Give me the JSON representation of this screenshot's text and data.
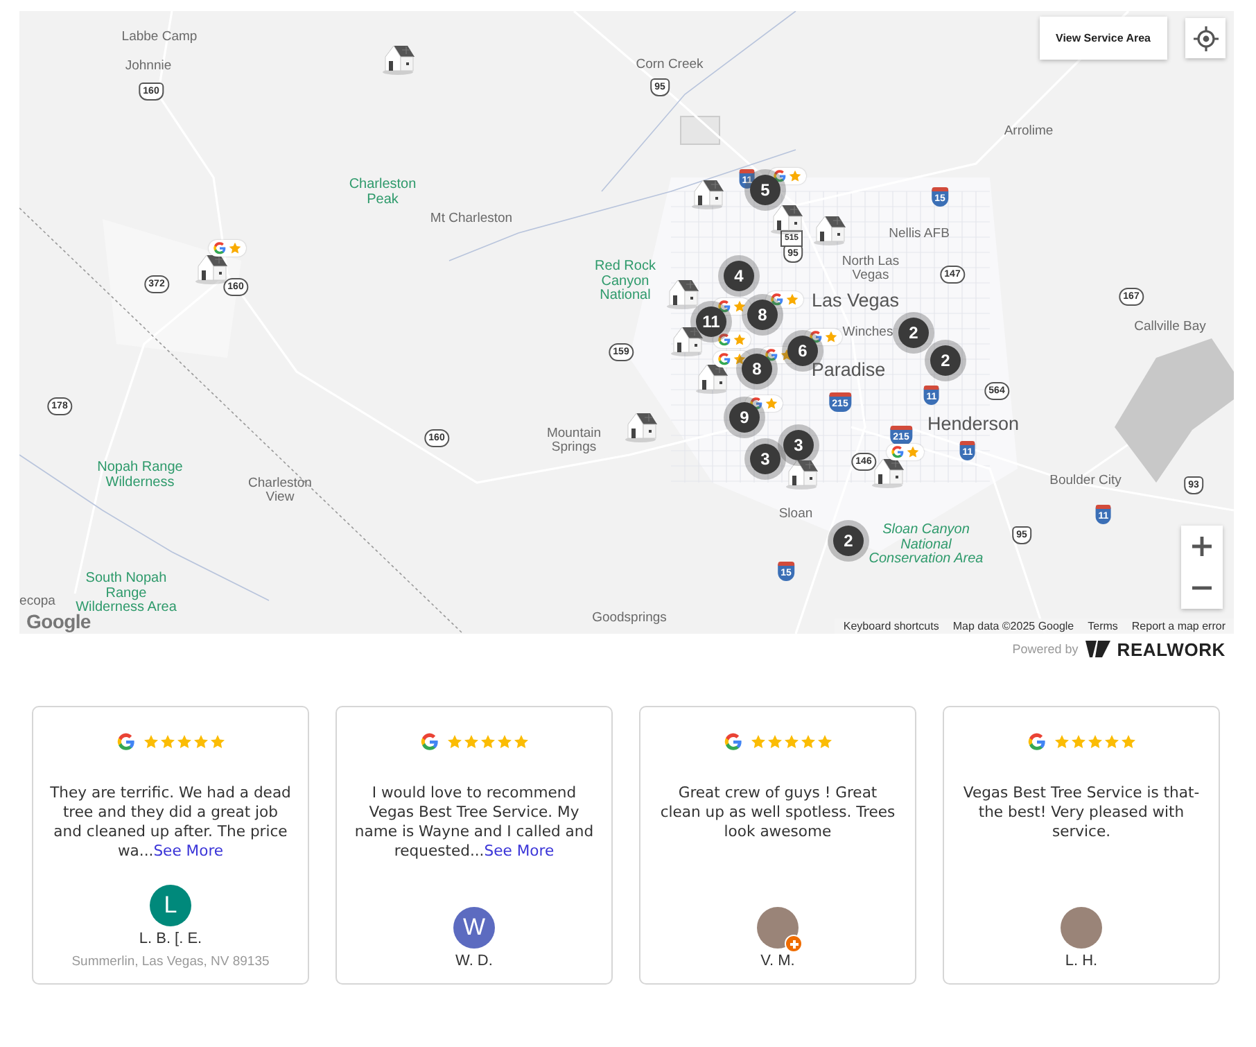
{
  "map": {
    "service_area_button": "View Service Area",
    "place_labels": [
      {
        "kind": "place",
        "text": "Labbe Camp"
      },
      {
        "kind": "place",
        "text": "Johnnie"
      },
      {
        "kind": "place",
        "text": "Corn Creek"
      },
      {
        "kind": "place",
        "text": "Arrolime"
      },
      {
        "kind": "park",
        "text": "Charleston Peak"
      },
      {
        "kind": "place",
        "text": "Mt Charleston"
      },
      {
        "kind": "park",
        "text": "Red Rock Canyon National"
      },
      {
        "kind": "place",
        "text": "Nellis AFB"
      },
      {
        "kind": "place",
        "text": "North Las Vegas"
      },
      {
        "kind": "city",
        "text": "Las Vegas"
      },
      {
        "kind": "place",
        "text": "Winches"
      },
      {
        "kind": "city",
        "text": "Paradise"
      },
      {
        "kind": "city",
        "text": "Henderson"
      },
      {
        "kind": "place",
        "text": "Mountain Springs"
      },
      {
        "kind": "park",
        "text": "Nopah Range Wilderness"
      },
      {
        "kind": "place",
        "text": "Charleston View"
      },
      {
        "kind": "place",
        "text": "Boulder City"
      },
      {
        "kind": "place",
        "text": "Callville Bay"
      },
      {
        "kind": "place",
        "text": "Sloan"
      },
      {
        "kind": "park",
        "text": "Sloan Canyon National Conservation Area"
      },
      {
        "kind": "park",
        "text": "South Nopah Range Wilderness Area"
      },
      {
        "kind": "place",
        "text": "Goodsprings"
      },
      {
        "kind": "place",
        "text": "ecopa"
      }
    ],
    "shields": [
      {
        "kind": "us",
        "text": "160"
      },
      {
        "kind": "us",
        "text": "95"
      },
      {
        "kind": "state",
        "text": "160"
      },
      {
        "kind": "state",
        "text": "372"
      },
      {
        "kind": "state",
        "text": "178"
      },
      {
        "kind": "state",
        "text": "160"
      },
      {
        "kind": "state",
        "text": "159"
      },
      {
        "kind": "interstate",
        "text": "15"
      },
      {
        "kind": "interstate",
        "text": "11"
      },
      {
        "kind": "us",
        "text": "95"
      },
      {
        "kind": "business",
        "text": "515"
      },
      {
        "kind": "state",
        "text": "147"
      },
      {
        "kind": "state",
        "text": "167"
      },
      {
        "kind": "interstate",
        "text": "215"
      },
      {
        "kind": "interstate",
        "text": "11"
      },
      {
        "kind": "state",
        "text": "564"
      },
      {
        "kind": "interstate",
        "text": "215"
      },
      {
        "kind": "state",
        "text": "146"
      },
      {
        "kind": "interstate",
        "text": "11"
      },
      {
        "kind": "us",
        "text": "93"
      },
      {
        "kind": "interstate",
        "text": "11"
      },
      {
        "kind": "us",
        "text": "95"
      },
      {
        "kind": "interstate",
        "text": "15"
      }
    ],
    "clusters": [
      "5",
      "4",
      "8",
      "11",
      "6",
      "8",
      "2",
      "2",
      "9",
      "3",
      "3",
      "2"
    ],
    "logo": "Google",
    "attribution": [
      "Keyboard shortcuts",
      "Map data ©2025 Google",
      "Terms",
      "Report a map error"
    ]
  },
  "powered_by": {
    "label": "Powered by",
    "brand": "REALWORK"
  },
  "reviews": [
    {
      "stars": 5,
      "text": "They are terrific. We had a dead tree and they did a great job and cleaned up after. The price wa...",
      "link": "See More",
      "author": "L. B. [. E.",
      "location": "Summerlin, Las Vegas, NV 89135",
      "avatar": {
        "kind": "initial",
        "letter": "L",
        "color": "#00897b",
        "badge": false
      }
    },
    {
      "stars": 5,
      "text": "I would love to recommend Vegas Best Tree Service. My name is Wayne and I called and requested...",
      "link": "See More",
      "author": "W. D.",
      "avatar": {
        "kind": "initial",
        "letter": "W",
        "color": "#5c6bc0",
        "badge": false
      }
    },
    {
      "stars": 5,
      "text": "Great crew of guys ! Great clean up as well spotless. Trees look awesome",
      "author": "V. M.",
      "avatar": {
        "kind": "photo",
        "badge": true
      }
    },
    {
      "stars": 5,
      "text": "Vegas Best Tree Service is that- the best! Very pleased with service.",
      "author": "L. H.",
      "avatar": {
        "kind": "photo",
        "badge": false
      }
    }
  ]
}
